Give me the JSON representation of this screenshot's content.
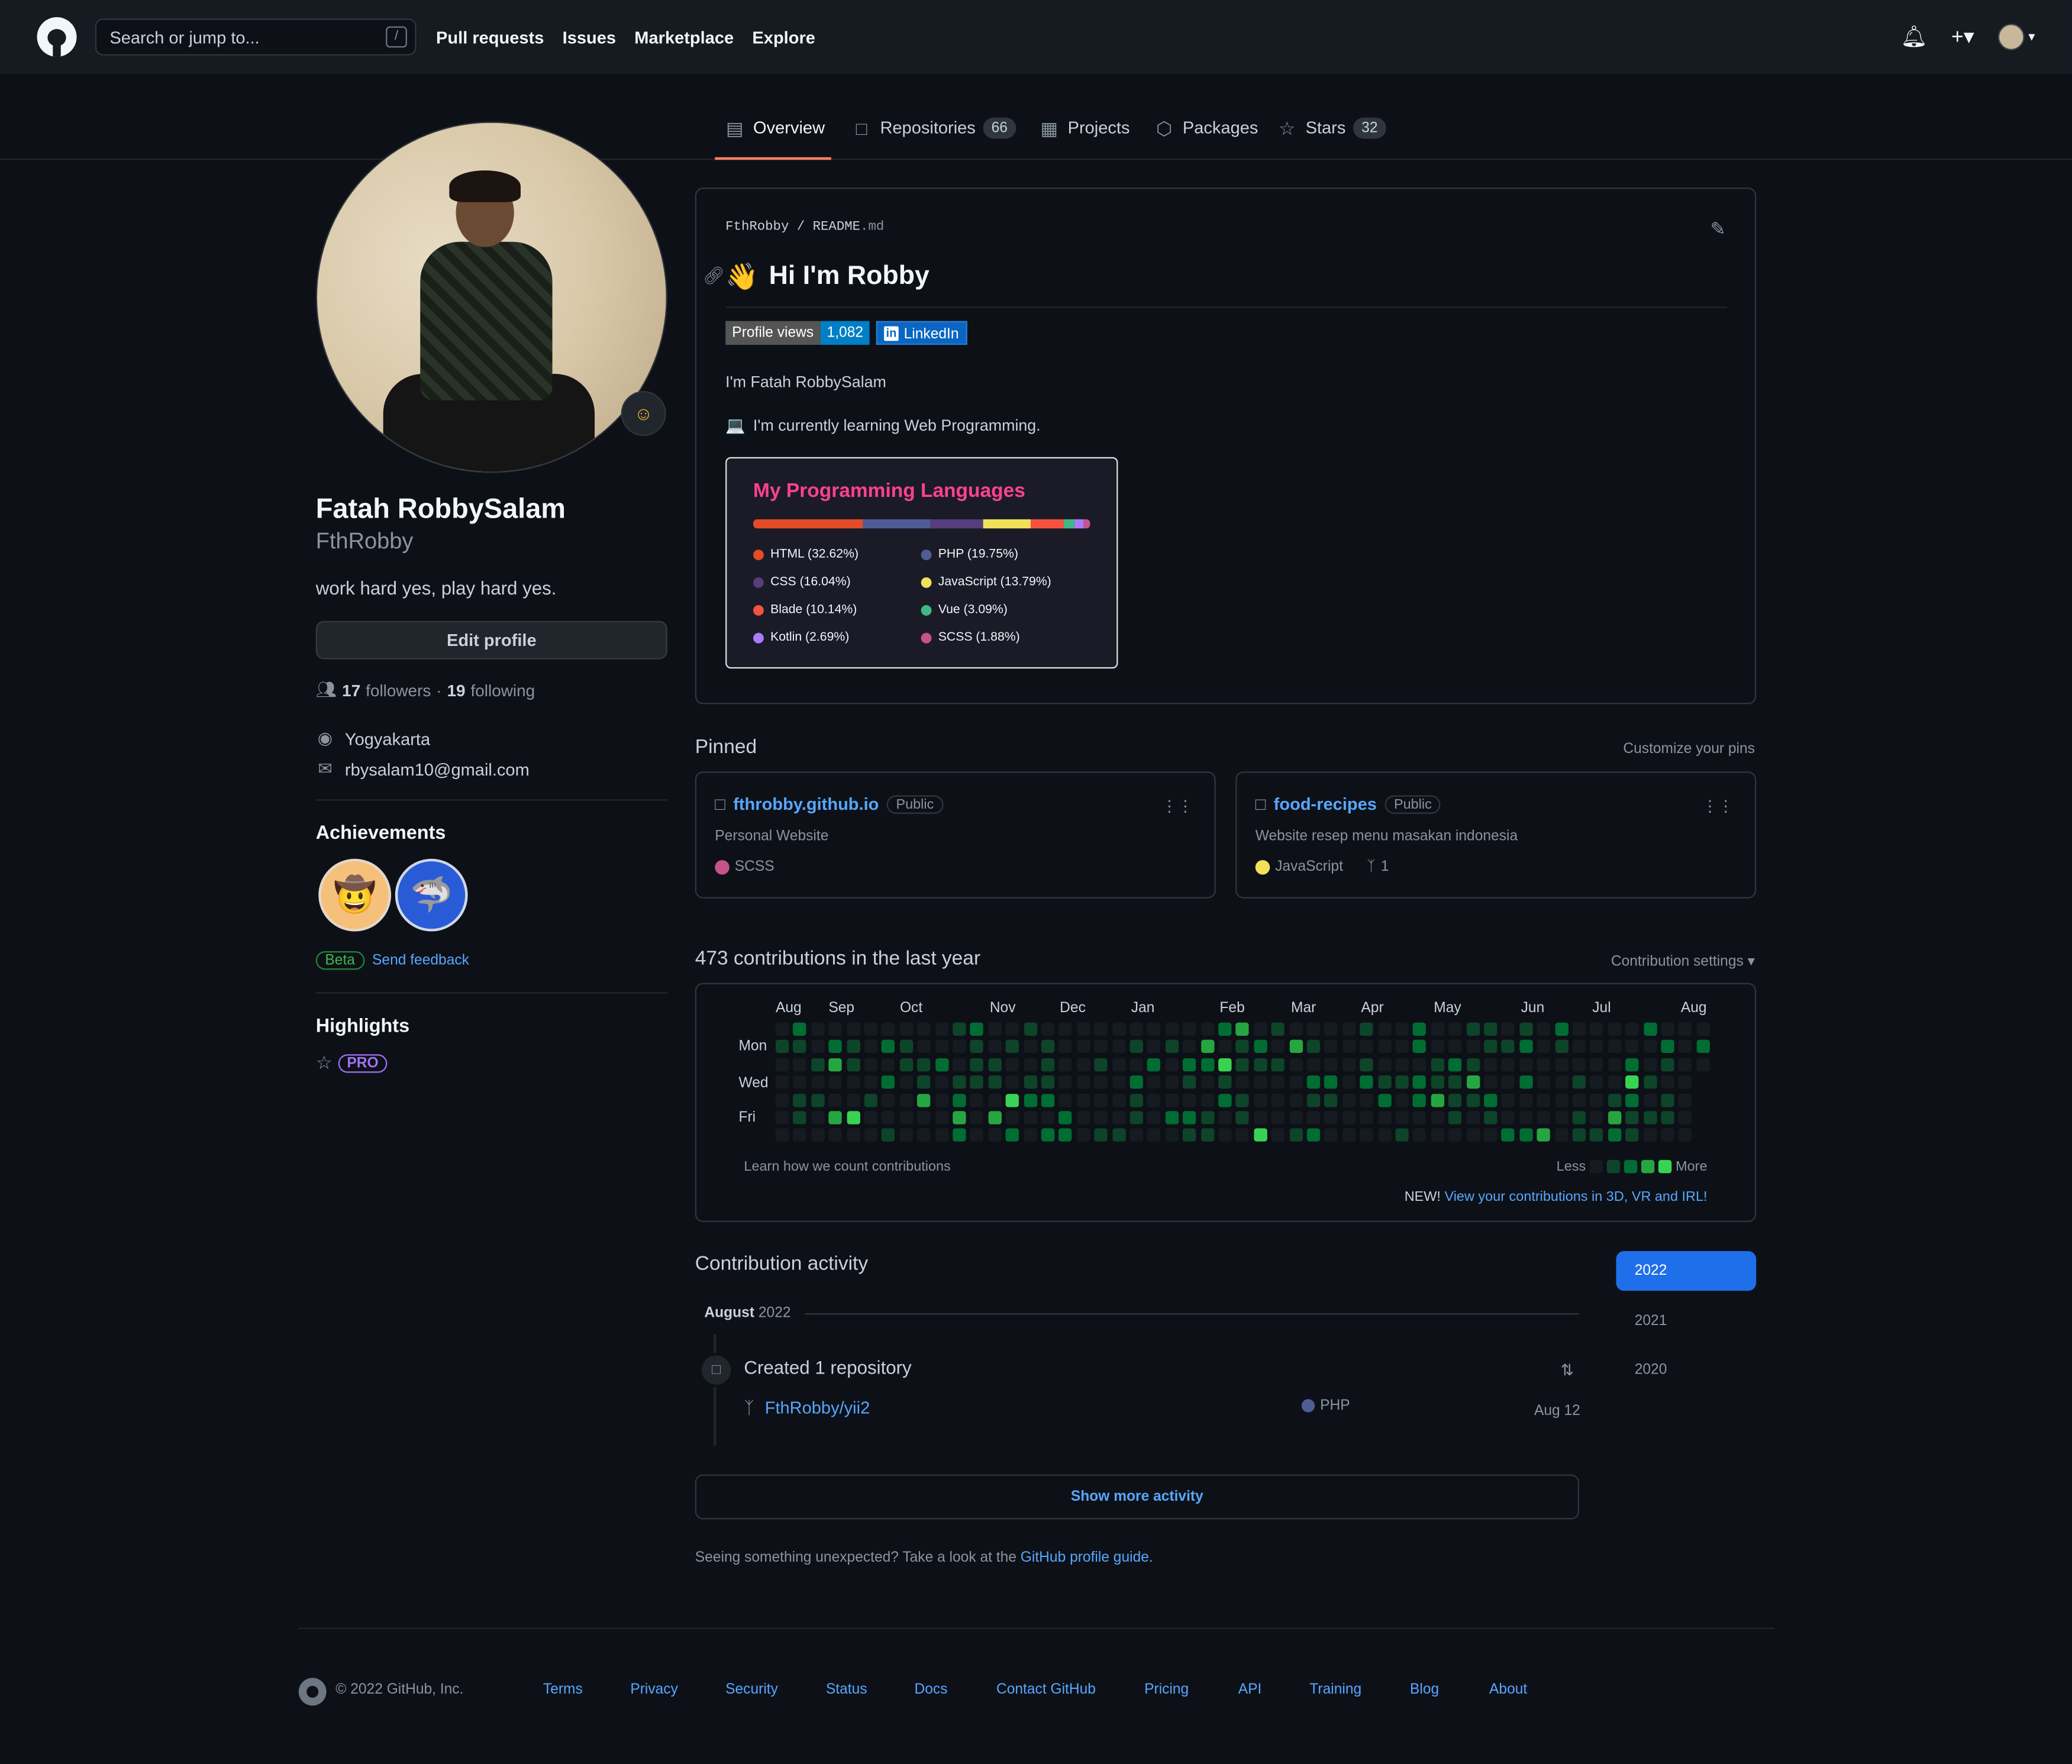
{
  "header": {
    "search_placeholder": "Search or jump to...",
    "slash": "/",
    "nav": [
      "Pull requests",
      "Issues",
      "Marketplace",
      "Explore"
    ]
  },
  "tabs": {
    "overview": "Overview",
    "repositories": "Repositories",
    "repositories_count": "66",
    "projects": "Projects",
    "packages": "Packages",
    "stars": "Stars",
    "stars_count": "32"
  },
  "profile": {
    "name": "Fatah RobbySalam",
    "login": "FthRobby",
    "bio": "work hard yes, play hard yes.",
    "edit": "Edit profile",
    "followers": "17",
    "followers_label": "followers",
    "sep": "·",
    "following": "19",
    "following_label": "following",
    "location": "Yogyakarta",
    "email": "rbysalam10@gmail.com"
  },
  "achievements": {
    "title": "Achievements",
    "beta": "Beta",
    "feedback": "Send feedback"
  },
  "highlights": {
    "title": "Highlights",
    "pro": "PRO"
  },
  "readme": {
    "owner": "FthRobby",
    "file": "README",
    "ext": ".md",
    "heading": "Hi I'm Robby",
    "wave": "👋",
    "views_label": "Profile views",
    "views": "1,082",
    "linkedin": "LinkedIn",
    "intro": "I'm Fatah RobbySalam",
    "learning_emoji": "💻",
    "learning": "I'm currently learning Web Programming."
  },
  "lang_card": {
    "title": "My Programming Languages",
    "langs": [
      {
        "name": "HTML (32.62%)",
        "color": "#e34c26",
        "pct": 32.62
      },
      {
        "name": "PHP (19.75%)",
        "color": "#4f5d95",
        "pct": 19.75
      },
      {
        "name": "CSS (16.04%)",
        "color": "#563d7c",
        "pct": 16.04
      },
      {
        "name": "JavaScript (13.79%)",
        "color": "#f1e05a",
        "pct": 13.79
      },
      {
        "name": "Blade (10.14%)",
        "color": "#f7523f",
        "pct": 10.14
      },
      {
        "name": "Vue (3.09%)",
        "color": "#41b883",
        "pct": 3.09
      },
      {
        "name": "Kotlin (2.69%)",
        "color": "#a97bff",
        "pct": 2.69
      },
      {
        "name": "SCSS (1.88%)",
        "color": "#c6538c",
        "pct": 1.88
      }
    ]
  },
  "pinned": {
    "title": "Pinned",
    "customize": "Customize your pins",
    "items": [
      {
        "name": "fthrobby.github.io",
        "vis": "Public",
        "desc": "Personal Website",
        "lang": "SCSS",
        "color": "#c6538c",
        "forks": ""
      },
      {
        "name": "food-recipes",
        "vis": "Public",
        "desc": "Website resep menu masakan indonesia",
        "lang": "JavaScript",
        "color": "#f1e05a",
        "forks": "1"
      }
    ]
  },
  "contrib": {
    "title": "473 contributions in the last year",
    "settings": "Contribution settings ▾",
    "months": [
      "Aug",
      "Sep",
      "Oct",
      "Nov",
      "Dec",
      "Jan",
      "Feb",
      "Mar",
      "Apr",
      "May",
      "Jun",
      "Jul",
      "Aug"
    ],
    "days": [
      "Mon",
      "Wed",
      "Fri"
    ],
    "learn": "Learn how we count contributions",
    "less": "Less",
    "more": "More",
    "new": "NEW!",
    "new_link": "View your contributions in 3D, VR and IRL!"
  },
  "activity": {
    "title": "Contribution activity",
    "years": [
      "2022",
      "2021",
      "2020"
    ],
    "month": "August",
    "year": "2022",
    "created": "Created 1 repository",
    "repo": "FthRobby/yii2",
    "lang": "PHP",
    "date": "Aug 12",
    "show_more": "Show more activity",
    "unexpected": "Seeing something unexpected? Take a look at the",
    "guide": "GitHub profile guide."
  },
  "footer": {
    "copy": "© 2022 GitHub, Inc.",
    "links": [
      "Terms",
      "Privacy",
      "Security",
      "Status",
      "Docs",
      "Contact GitHub",
      "Pricing",
      "API",
      "Training",
      "Blog",
      "About"
    ]
  },
  "colors": {
    "accent": "#f78166",
    "link": "#58a6ff",
    "green": [
      "#161b22",
      "#0e4429",
      "#006d32",
      "#26a641",
      "#39d353"
    ]
  }
}
